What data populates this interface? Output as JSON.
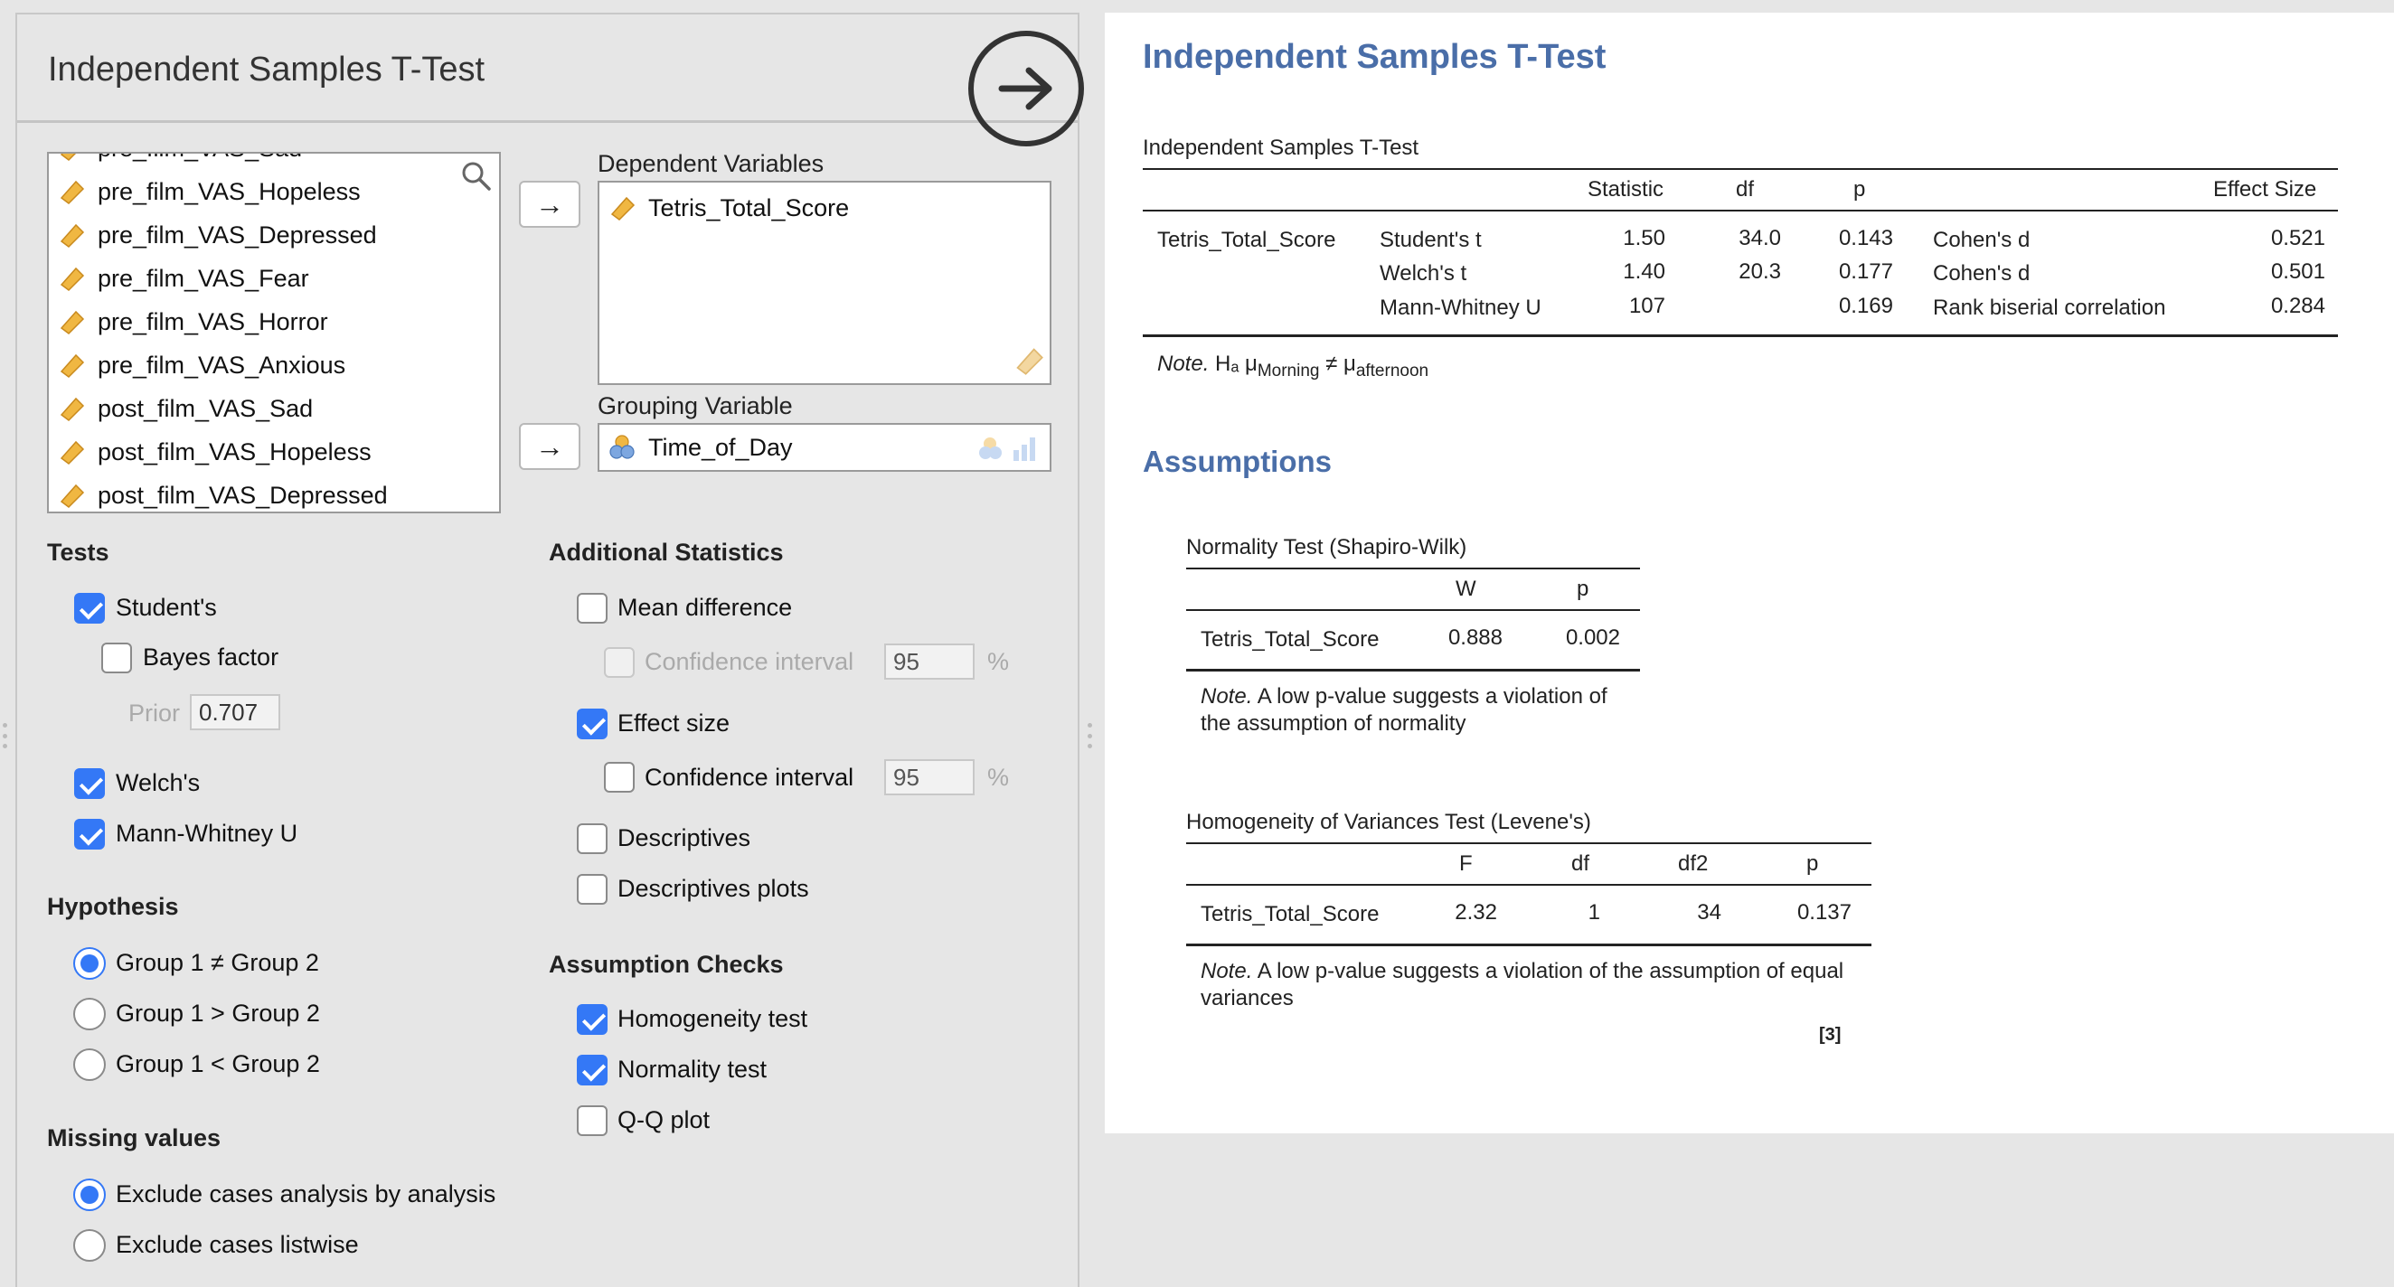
{
  "panel": {
    "title": "Independent Samples T-Test",
    "variables_list": [
      "pre_film_VAS_Sad",
      "pre_film_VAS_Hopeless",
      "pre_film_VAS_Depressed",
      "pre_film_VAS_Fear",
      "pre_film_VAS_Horror",
      "pre_film_VAS_Anxious",
      "post_film_VAS_Sad",
      "post_film_VAS_Hopeless",
      "post_film_VAS_Depressed"
    ],
    "dependent_label": "Dependent Variables",
    "dependent_value": "Tetris_Total_Score",
    "grouping_label": "Grouping Variable",
    "grouping_value": "Time_of_Day",
    "arrow": "→"
  },
  "tests": {
    "heading": "Tests",
    "students": "Student's",
    "bayes": "Bayes factor",
    "prior_label": "Prior",
    "prior_value": "0.707",
    "welchs": "Welch's",
    "mann_whitney": "Mann-Whitney U"
  },
  "hypothesis": {
    "heading": "Hypothesis",
    "opt1": "Group 1 ≠ Group 2",
    "opt2": "Group 1 > Group 2",
    "opt3": "Group 1 < Group 2"
  },
  "missing": {
    "heading": "Missing values",
    "opt1": "Exclude cases analysis by analysis",
    "opt2": "Exclude cases listwise"
  },
  "additional": {
    "heading": "Additional Statistics",
    "mean_diff": "Mean difference",
    "ci_label": "Confidence interval",
    "ci_value": "95",
    "pct": "%",
    "effect_size": "Effect size",
    "es_ci_label": "Confidence interval",
    "es_ci_value": "95",
    "descriptives": "Descriptives",
    "descriptives_plots": "Descriptives plots"
  },
  "assumption_checks": {
    "heading": "Assumption Checks",
    "homogeneity": "Homogeneity test",
    "normality": "Normality test",
    "qq": "Q-Q plot"
  },
  "results": {
    "title": "Independent Samples T-Test",
    "ttest": {
      "caption": "Independent Samples T-Test",
      "headers": {
        "statistic": "Statistic",
        "df": "df",
        "p": "p",
        "effect_size": "Effect Size"
      },
      "variable": "Tetris_Total_Score",
      "rows": [
        {
          "test": "Student's t",
          "statistic": "1.50",
          "df": "34.0",
          "p": "0.143",
          "es_name": "Cohen's d",
          "es": "0.521"
        },
        {
          "test": "Welch's t",
          "statistic": "1.40",
          "df": "20.3",
          "p": "0.177",
          "es_name": "Cohen's d",
          "es": "0.501"
        },
        {
          "test": "Mann-Whitney U",
          "statistic": "107",
          "df": "",
          "p": "0.169",
          "es_name": "Rank biserial correlation",
          "es": "0.284"
        }
      ],
      "note_label": "Note.",
      "note_h": "Hₐ μ",
      "note_sub1": "Morning",
      "note_neq": " ≠ μ",
      "note_sub2": "afternoon"
    },
    "assumptions_title": "Assumptions",
    "normality": {
      "caption": "Normality Test (Shapiro-Wilk)",
      "headers": {
        "w": "W",
        "p": "p"
      },
      "variable": "Tetris_Total_Score",
      "w": "0.888",
      "p": "0.002",
      "note_label": "Note.",
      "note_text": "A low p-value suggests a violation of the assumption of normality"
    },
    "levene": {
      "caption": "Homogeneity of Variances Test (Levene's)",
      "headers": {
        "f": "F",
        "df": "df",
        "df2": "df2",
        "p": "p"
      },
      "variable": "Tetris_Total_Score",
      "f": "2.32",
      "df": "1",
      "df2": "34",
      "p": "0.137",
      "note_label": "Note.",
      "note_text": "A low p-value suggests a violation of the assumption of equal variances"
    },
    "ref": "[3]"
  }
}
